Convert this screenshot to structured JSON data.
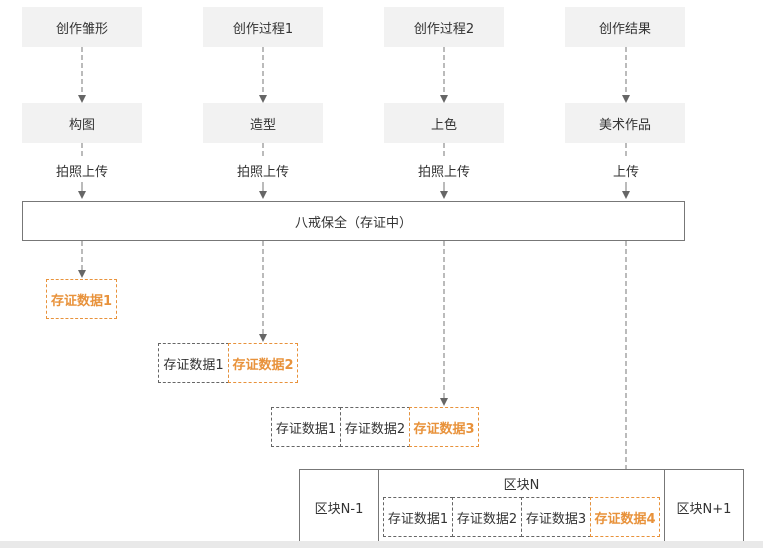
{
  "stages": [
    "创作雏形",
    "创作过程1",
    "创作过程2",
    "创作结果"
  ],
  "steps": [
    "构图",
    "造型",
    "上色",
    "美术作品"
  ],
  "upload_labels": [
    "拍照上传",
    "拍照上传",
    "拍照上传",
    "上传"
  ],
  "storage": "八戒保全（存证中）",
  "data_items": [
    "存证数据1",
    "存证数据2",
    "存证数据3",
    "存证数据4"
  ],
  "blocks": {
    "prev": "区块N-1",
    "current": "区块N",
    "next": "区块N+1"
  },
  "colors": {
    "accent": "#e8923b",
    "line": "#666666",
    "box": "#f2f2f2"
  }
}
